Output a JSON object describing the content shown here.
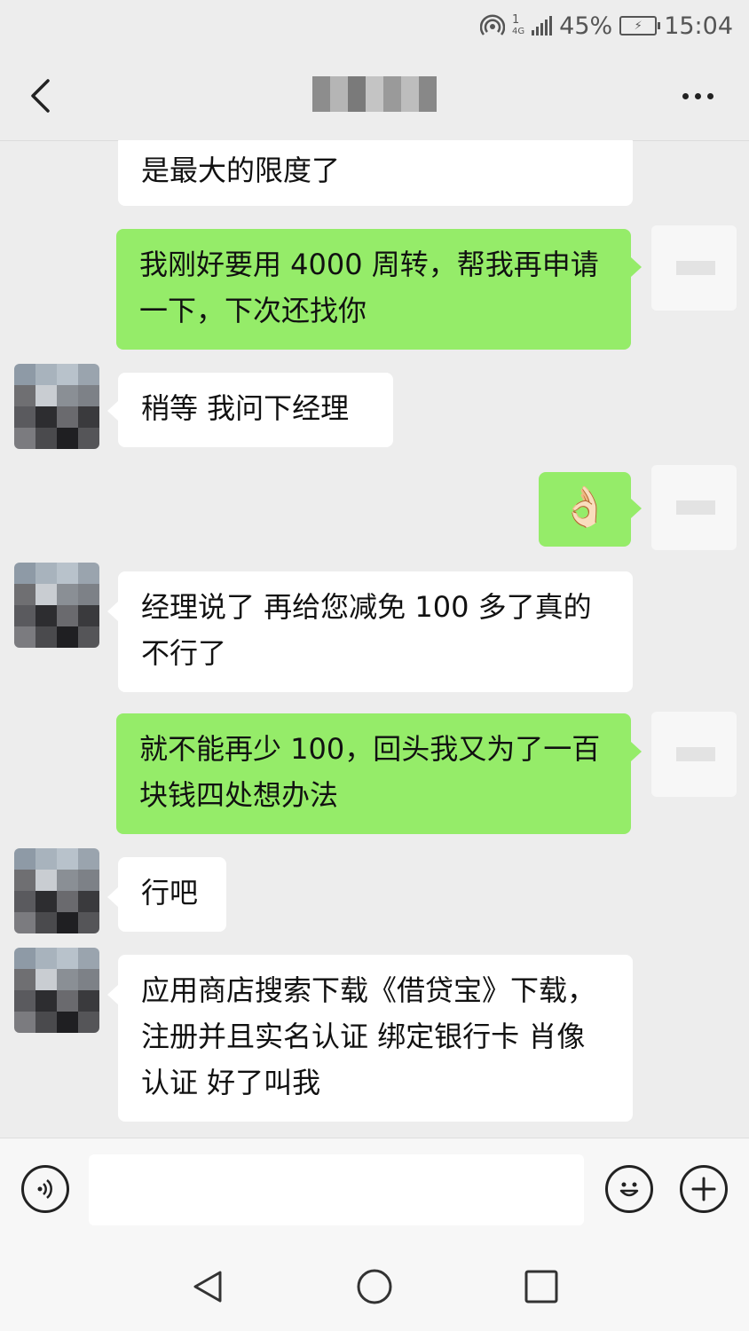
{
  "status_bar": {
    "network": "4G",
    "sim": "1",
    "battery": "45%",
    "time": "15:04"
  },
  "header": {
    "back_icon": "chevron-left-icon",
    "more_icon": "more-dots-icon"
  },
  "messages": [
    {
      "side": "left",
      "text": "是最大的限度了"
    },
    {
      "side": "right",
      "text": "我刚好要用 4000 周转，帮我再申请一下，下次还找你"
    },
    {
      "side": "left",
      "text": "稍等 我问下经理"
    },
    {
      "side": "right",
      "text": "👌🏻"
    },
    {
      "side": "left",
      "text": "经理说了  再给您减免 100  多了真的不行了"
    },
    {
      "side": "right",
      "text": "就不能再少 100，回头我又为了一百块钱四处想办法"
    },
    {
      "side": "left",
      "text": "行吧"
    },
    {
      "side": "left",
      "text": "应用商店搜索下载《借贷宝》下载，注册并且实名认证 绑定银行卡 肖像认证  好了叫我"
    }
  ],
  "input_bar": {
    "voice_icon": "voice-icon",
    "emoji_icon": "emoji-icon",
    "plus_icon": "plus-icon",
    "input_value": ""
  },
  "nav_bar": {
    "back_icon": "triangle-back-icon",
    "home_icon": "circle-home-icon",
    "recent_icon": "square-recent-icon"
  },
  "colors": {
    "background": "#ededed",
    "bubble_self": "#95ec69",
    "bubble_other": "#ffffff"
  }
}
